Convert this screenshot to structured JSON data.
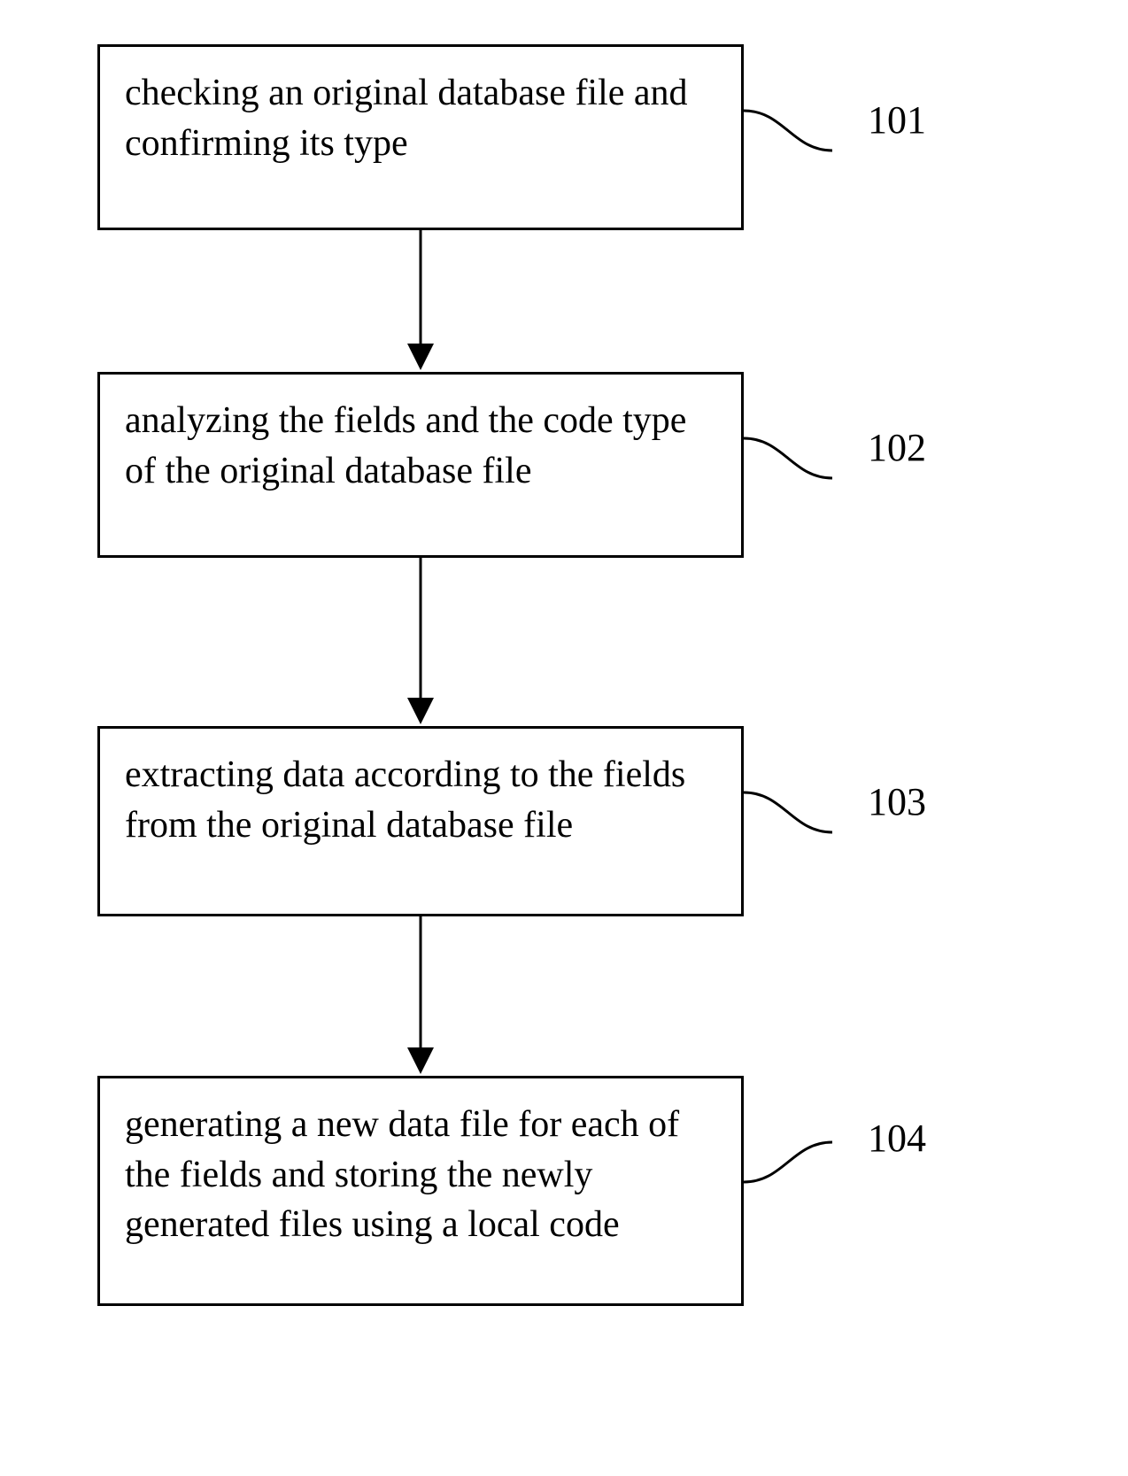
{
  "chart_data": {
    "type": "flowchart",
    "nodes": [
      {
        "id": "101",
        "text": "checking an original database file and confirming its type"
      },
      {
        "id": "102",
        "text": "analyzing the fields and the code type of the original database file"
      },
      {
        "id": "103",
        "text": "extracting data according to the fields from the original database file"
      },
      {
        "id": "104",
        "text": "generating a new data file for each of the fields and storing the newly generated files using a local code"
      }
    ],
    "edges": [
      {
        "from": "101",
        "to": "102"
      },
      {
        "from": "102",
        "to": "103"
      },
      {
        "from": "103",
        "to": "104"
      }
    ]
  },
  "boxes": {
    "b101": {
      "text": "checking an original database file and confirming its type",
      "label": "101"
    },
    "b102": {
      "text": "analyzing the fields and the code type of the original database file",
      "label": "102"
    },
    "b103": {
      "text": "extracting data according to the fields from the original database file",
      "label": "103"
    },
    "b104": {
      "text": "generating a new data file for each of the fields and storing the newly generated files using a local code",
      "label": "104"
    }
  }
}
